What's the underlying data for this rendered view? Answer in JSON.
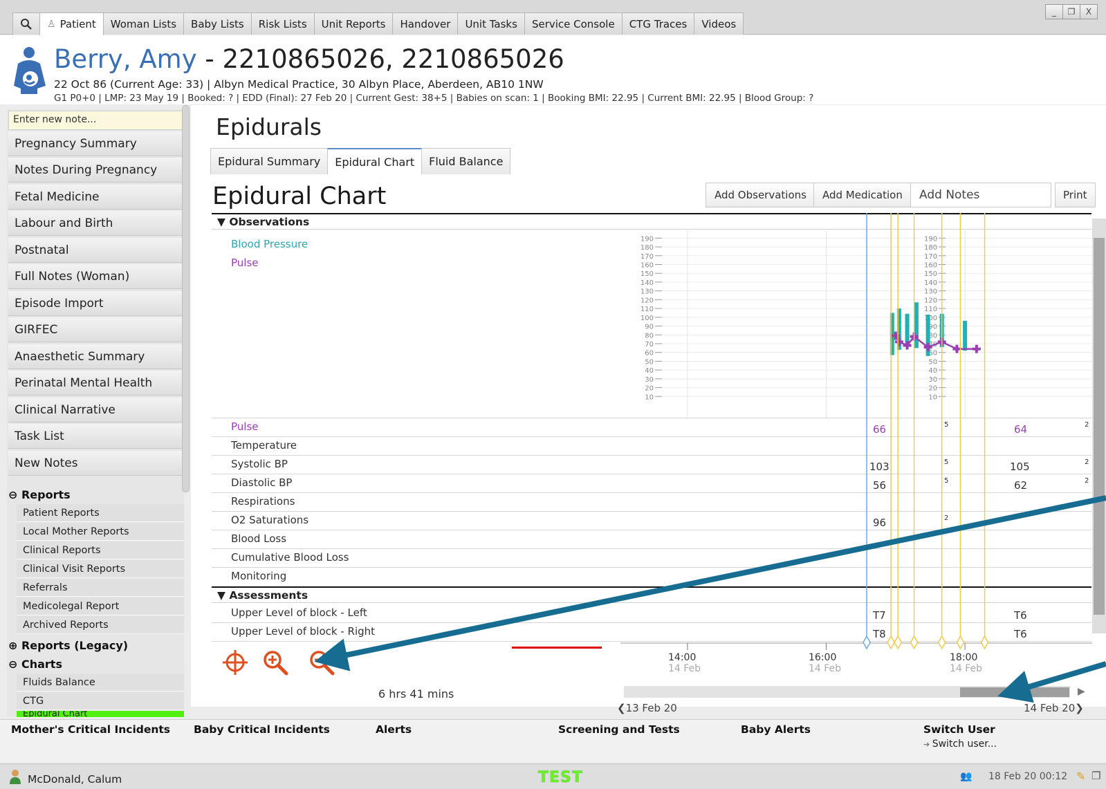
{
  "top_tabs": [
    {
      "label": "Patient"
    },
    {
      "label": "Woman Lists"
    },
    {
      "label": "Baby Lists"
    },
    {
      "label": "Risk Lists"
    },
    {
      "label": "Unit Reports"
    },
    {
      "label": "Handover"
    },
    {
      "label": "Unit Tasks"
    },
    {
      "label": "Service Console"
    },
    {
      "label": "CTG Traces"
    },
    {
      "label": "Videos"
    }
  ],
  "window_buttons": {
    "minimize": "_",
    "restore": "❐",
    "close": "X"
  },
  "patient": {
    "name": "Berry, Amy",
    "ids": " - 2210865026, 2210865026",
    "line1": "22 Oct 86 (Current Age: 33) | Albyn Medical Practice, 30 Albyn Place, Aberdeen, AB10 1NW",
    "line2": "G1 P0+0 | LMP: 23 May 19 | Booked: ? | EDD (Final): 27 Feb 20 | Current Gest: 38+5 | Babies on scan: 1 | Booking BMI: 22.95 | Current BMI: 22.95 | Blood Group: ?"
  },
  "nav": {
    "note_placeholder": "Enter new note...",
    "items": [
      "Pregnancy Summary",
      "Notes During Pregnancy",
      "Fetal Medicine",
      "Labour and Birth",
      "Postnatal",
      "Full Notes (Woman)",
      "Episode Import",
      "GIRFEC",
      "Anaesthetic Summary",
      "Perinatal Mental Health",
      "Clinical Narrative",
      "Task List",
      "New Notes"
    ],
    "reports_label": "Reports",
    "reports": [
      "Patient Reports",
      "Local Mother Reports",
      "Clinical Reports",
      "Clinical Visit Reports",
      "Referrals",
      "Medicolegal Report",
      "Archived Reports"
    ],
    "reports_legacy_label": "Reports (Legacy)",
    "charts_label": "Charts",
    "charts": [
      "Fluids Balance",
      "CTG",
      "Epidural Chart"
    ],
    "expander_open": "⊖",
    "expander_closed": "⊕"
  },
  "main": {
    "section_title": "Epidurals",
    "subtabs": [
      "Epidural Summary",
      "Epidural Chart",
      "Fluid Balance"
    ],
    "chart_title": "Epidural Chart",
    "buttons": {
      "add_observations": "Add Observations",
      "add_medication": "Add Medication",
      "add_notes": "Add Notes",
      "print": "Print"
    }
  },
  "observations": {
    "heading": "▼ Observations",
    "legend": [
      "Blood Pressure",
      "Pulse"
    ],
    "rows": [
      "Pulse",
      "Temperature",
      "Systolic BP",
      "Diastolic BP",
      "Respirations",
      "O2 Saturations",
      "Blood Loss",
      "Cumulative Blood Loss",
      "Monitoring"
    ],
    "values": {
      "pulse": [
        "66",
        "5",
        "64",
        "2"
      ],
      "systolic": [
        "103",
        "5",
        "105",
        "2"
      ],
      "diastolic": [
        "56",
        "5",
        "62",
        "2"
      ],
      "o2": [
        "96",
        "2"
      ]
    }
  },
  "assessments": {
    "heading": "▼ Assessments",
    "rows": [
      "Upper Level of block - Left",
      "Upper Level of block - Right"
    ],
    "values": {
      "left": [
        "T7",
        "T6"
      ],
      "right": [
        "T8",
        "T6"
      ]
    }
  },
  "time_axis": [
    {
      "time": "14:00",
      "date": "14 Feb"
    },
    {
      "time": "16:00",
      "date": "14 Feb"
    },
    {
      "time": "18:00",
      "date": "14 Feb"
    }
  ],
  "scroll_range": {
    "left": "❮13 Feb 20",
    "right": "14 Feb 20❯"
  },
  "duration": "6 hrs 41 mins",
  "chart_data": {
    "type": "line",
    "yticks": [
      10,
      20,
      30,
      40,
      50,
      60,
      70,
      80,
      90,
      100,
      110,
      120,
      130,
      140,
      150,
      160,
      170,
      180,
      190
    ],
    "ylim": [
      0,
      195
    ],
    "series": [
      {
        "name": "Pulse",
        "x": [
          "17:00",
          "17:03",
          "17:10",
          "17:16",
          "17:28",
          "17:40",
          "17:53",
          "18:10"
        ],
        "y": [
          79,
          72,
          68,
          78,
          66,
          72,
          64,
          64
        ]
      },
      {
        "name": "Blood Pressure",
        "bars": [
          {
            "x": "16:57",
            "low": 57,
            "high": 105
          },
          {
            "x": "17:03",
            "low": 63,
            "high": 110
          },
          {
            "x": "17:10",
            "low": 68,
            "high": 104
          },
          {
            "x": "17:18",
            "low": 65,
            "high": 117
          },
          {
            "x": "17:28",
            "low": 56,
            "high": 103
          },
          {
            "x": "17:40",
            "low": 66,
            "high": 104
          },
          {
            "x": "18:00",
            "low": 62,
            "high": 96
          }
        ]
      }
    ],
    "colors": {
      "pulse": "#9b3fb5",
      "bp": "#1fb1b5",
      "marker_blue": "#6aa9e0",
      "marker_yellow": "#f5c94a"
    }
  },
  "bottom": {
    "mother_incidents": "Mother's Critical Incidents",
    "baby_incidents": "Baby Critical Incidents",
    "alerts": "Alerts",
    "screening": "Screening and Tests",
    "baby_alerts": "Baby Alerts",
    "switch_user": "Switch User",
    "switch_link": "Switch user..."
  },
  "status": {
    "user": "McDonald, Calum",
    "env": "TEST",
    "clock": "18 Feb 20 00:12"
  }
}
